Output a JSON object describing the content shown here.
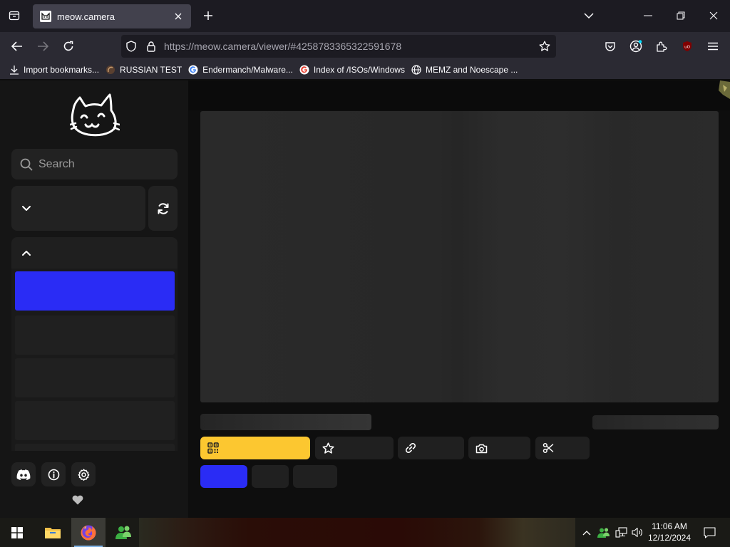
{
  "browser": {
    "tab": {
      "title": "meow.camera"
    },
    "url": {
      "host": "https://meow.camera",
      "path": "/viewer/#4258783365322591678"
    },
    "bookmarks": [
      {
        "label": "Import bookmarks...",
        "icon": "import-icon"
      },
      {
        "label": "RUSSIAN TEST",
        "icon": "site-favicon"
      },
      {
        "label": "Endermanch/Malware...",
        "icon": "google-icon"
      },
      {
        "label": "Index of /ISOs/Windows",
        "icon": "google-icon"
      },
      {
        "label": "MEMZ and Noescape ...",
        "icon": "globe-icon"
      }
    ]
  },
  "sidebar": {
    "search_placeholder": "Search"
  },
  "colors": {
    "accent_blue": "#2a2cf5",
    "accent_yellow": "#fcc730",
    "sidebar_bg": "#151515"
  },
  "taskbar": {
    "time": "11:06 AM",
    "date": "12/12/2024"
  }
}
